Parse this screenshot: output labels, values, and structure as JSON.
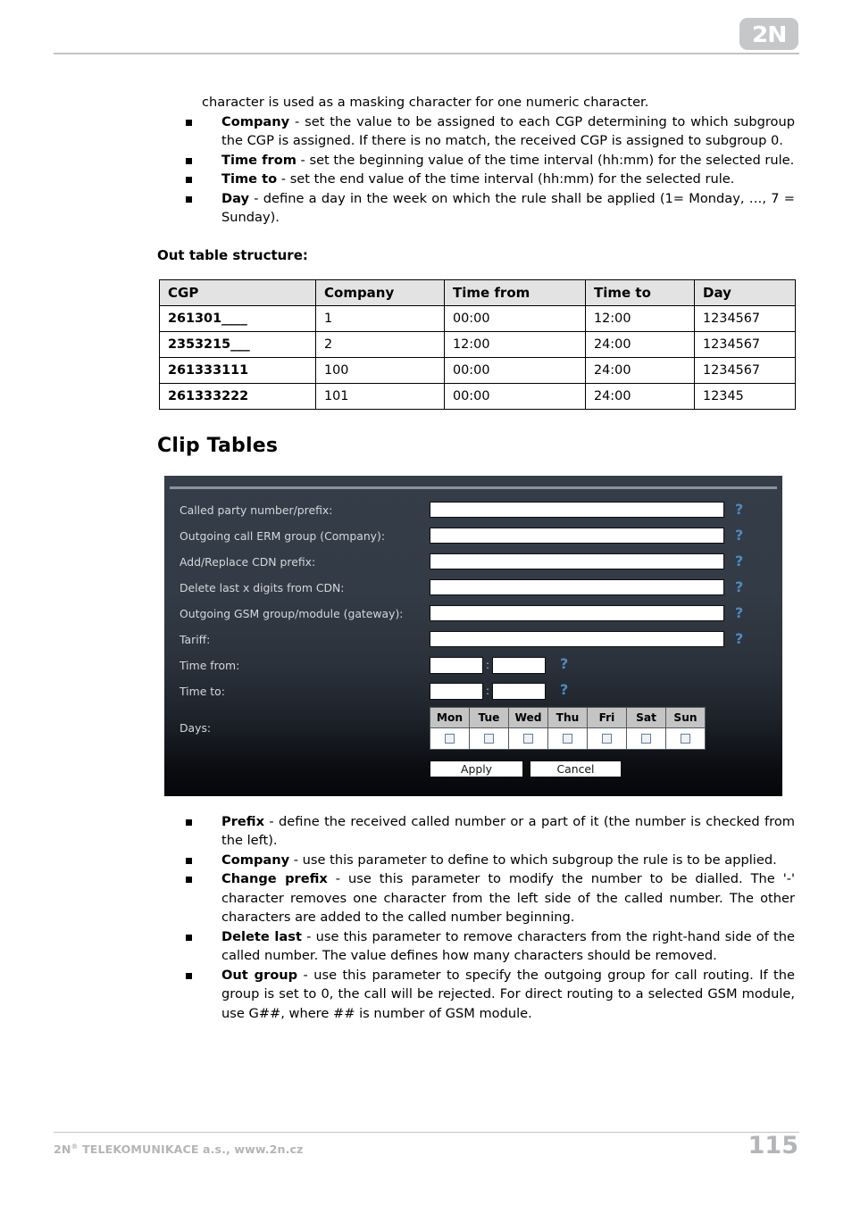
{
  "header": {
    "logo_text": "2N"
  },
  "intro": {
    "lead_line": "character is used as a masking character for one numeric character."
  },
  "top_bullets": [
    {
      "term": "Company",
      "text": " - set the value to be assigned to each CGP determining to which subgroup the CGP is assigned. If there is no match, the received CGP is assigned to subgroup 0."
    },
    {
      "term": "Time from",
      "text": " - set the beginning value of the time interval (hh:mm) for the selected rule."
    },
    {
      "term": "Time to",
      "text": " - set the end value of the time interval (hh:mm) for the selected rule."
    },
    {
      "term": "Day",
      "text": " - define a day in the week on which the rule shall be applied (1= Monday, …, 7 = Sunday)."
    }
  ],
  "out_table": {
    "caption": "Out table structure:",
    "headers": [
      "CGP",
      "Company",
      "Time from",
      "Time to",
      "Day"
    ],
    "rows": [
      [
        "261301____",
        "1",
        "00:00",
        "12:00",
        "1234567"
      ],
      [
        "2353215___",
        "2",
        "12:00",
        "24:00",
        "1234567"
      ],
      [
        "261333111",
        "100",
        "00:00",
        "24:00",
        "1234567"
      ],
      [
        "261333222",
        "101",
        "00:00",
        "24:00",
        "12345"
      ]
    ]
  },
  "clip_tables": {
    "heading": "Clip Tables"
  },
  "gsm_form": {
    "help_glyph": "?",
    "time_separator": ":",
    "fields": [
      {
        "label": "Called party number/prefix:",
        "value": ""
      },
      {
        "label": "Outgoing call ERM group (Company):",
        "value": ""
      },
      {
        "label": "Add/Replace CDN prefix:",
        "value": ""
      },
      {
        "label": "Delete last x digits from CDN:",
        "value": ""
      },
      {
        "label": "Outgoing GSM group/module (gateway):",
        "value": ""
      },
      {
        "label": "Tariff:",
        "value": ""
      }
    ],
    "time_from": {
      "label": "Time from:",
      "hours": "",
      "minutes": ""
    },
    "time_to": {
      "label": "Time to:",
      "hours": "",
      "minutes": ""
    },
    "days": {
      "label": "Days:",
      "names": [
        "Mon",
        "Tue",
        "Wed",
        "Thu",
        "Fri",
        "Sat",
        "Sun"
      ],
      "checked": [
        false,
        false,
        false,
        false,
        false,
        false,
        false
      ]
    },
    "buttons": {
      "apply": "Apply",
      "cancel": "Cancel"
    },
    "colors": {
      "panel_top": "#343d48",
      "panel_bottom": "#050609",
      "help_blue": "#4c8cc0",
      "day_header": "#c4c4c4"
    }
  },
  "bottom_bullets": [
    {
      "term": "Prefix",
      "text": " - define the received called number or a part of it (the number is checked from the left)."
    },
    {
      "term": "Company",
      "text": " - use this parameter to define to which subgroup the rule is to be applied."
    },
    {
      "term": "Change prefix",
      "text": " - use this parameter to modify the number to be dialled. The '-' character removes one character from the left side of the called number. The other characters are added to the called number beginning."
    },
    {
      "term": "Delete last",
      "text": " - use this parameter to remove characters from the right-hand side of the called number. The value defines how many characters should be removed."
    },
    {
      "term": "Out group",
      "text": " - use this parameter to specify the outgoing group for call routing. If the group is set to 0, the call will be rejected. For direct routing to a selected GSM module, use G##, where ## is number of GSM module."
    }
  ],
  "footer": {
    "company_prefix": "2N",
    "company_sup": "®",
    "company_rest": " TELEKOMUNIKACE a.s., www.2n.cz",
    "page_number": "115"
  }
}
